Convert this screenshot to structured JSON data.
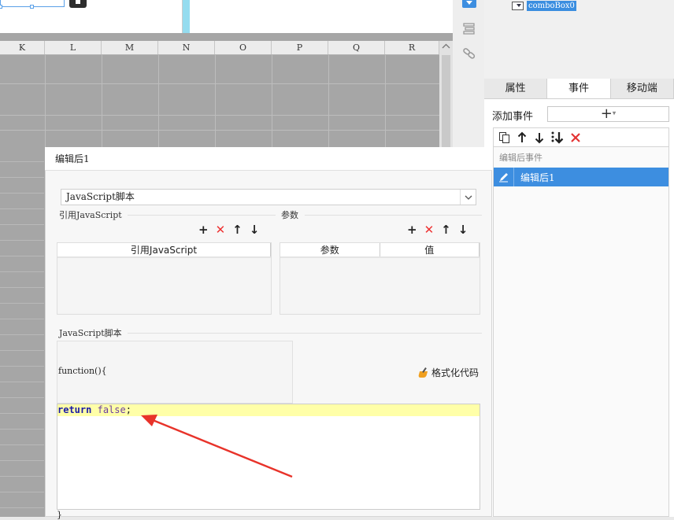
{
  "grid": {
    "columns": [
      "K",
      "L",
      "M",
      "N",
      "O",
      "P",
      "Q",
      "R"
    ]
  },
  "tree": {
    "widget_label": "comboBox0"
  },
  "right_panel": {
    "tabs": [
      "属性",
      "事件",
      "移动端"
    ],
    "active_tab": "事件",
    "add_event_label": "添加事件",
    "add_button_glyph": "+",
    "event_group_label": "编辑后事件",
    "event_item_label": "编辑后1"
  },
  "dialog": {
    "title": "编辑后1",
    "script_type": "JavaScript脚本",
    "ref_js_section": "引用JavaScript",
    "params_section": "参数",
    "ref_js_col": "引用JavaScript",
    "param_cols": [
      "参数",
      "值"
    ],
    "script_section": "JavaScript脚本",
    "function_header": "function(){",
    "format_code_label": "格式化代码",
    "code_keyword": "return",
    "code_literal": "false",
    "code_tail": ";",
    "closing_brace": "}"
  },
  "colors": {
    "accent_blue": "#3d8ee0",
    "delete_red": "#e33333",
    "highlight_yellow": "#ffffa8",
    "arrow_red": "#e8332a"
  },
  "icons": [
    "copy-icon",
    "up-arrow-icon",
    "down-arrow-icon",
    "sort-icon",
    "delete-icon",
    "add-icon",
    "pencil-icon",
    "broom-icon",
    "link-icon",
    "layers-icon"
  ]
}
